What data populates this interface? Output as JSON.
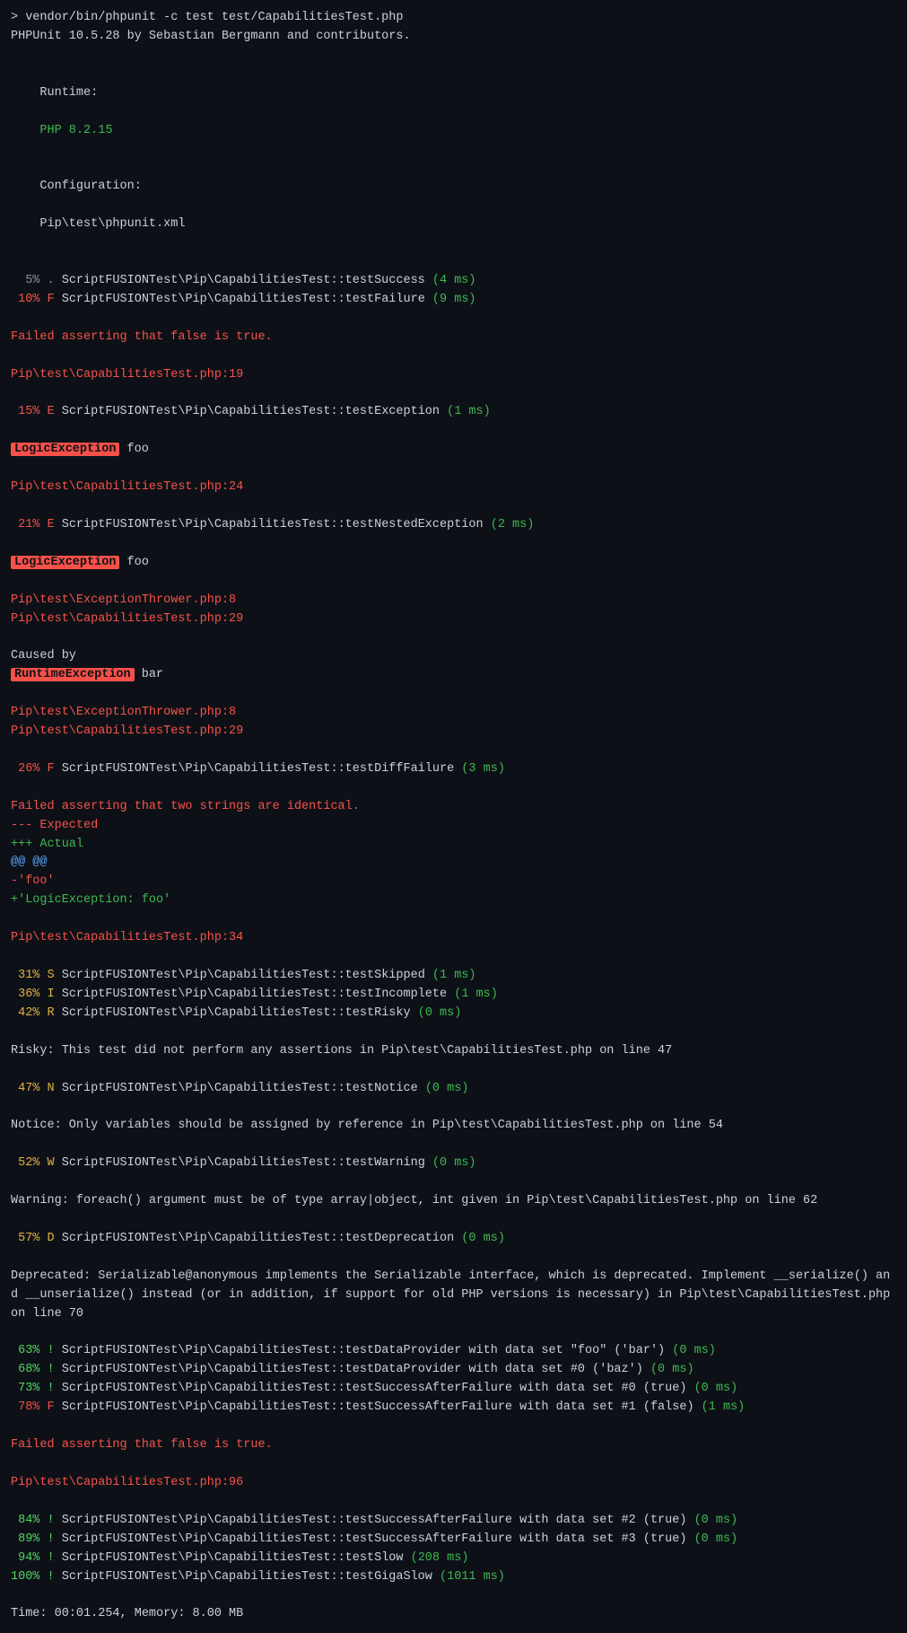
{
  "terminal": {
    "command": "> vendor/bin/phpunit -c test test/CapabilitiesTest.php",
    "phpunit_version": "PHPUnit 10.5.28 by Sebastian Bergmann and contributors.",
    "runtime_label": "Runtime:",
    "runtime_value": "PHP 8.2.15",
    "config_label": "Configuration:",
    "config_value": "Pip\\test\\phpunit.xml",
    "lines": [
      {
        "type": "blank"
      },
      {
        "type": "test_line",
        "percent": "5%",
        "status": ".",
        "status_color": "green",
        "test": "ScriptFUSIONTest\\Pip\\CapabilitiesTest::testSuccess",
        "time": "(4 ms)"
      },
      {
        "type": "test_line",
        "percent": "10%",
        "status": "F",
        "status_color": "red",
        "test": "ScriptFUSIONTest\\Pip\\CapabilitiesTest::testFailure",
        "time": "(9 ms)"
      },
      {
        "type": "blank"
      },
      {
        "type": "error_msg",
        "text": "Failed asserting that false is true."
      },
      {
        "type": "blank"
      },
      {
        "type": "file_ref",
        "text": "Pip\\test\\CapabilitiesTest.php:19"
      },
      {
        "type": "blank"
      },
      {
        "type": "test_line",
        "percent": "15%",
        "status": "E",
        "status_color": "red",
        "test": "ScriptFUSIONTest\\Pip\\CapabilitiesTest::testException",
        "time": "(1 ms)"
      },
      {
        "type": "blank"
      },
      {
        "type": "exception_line",
        "badge": "LogicException",
        "message": " foo"
      },
      {
        "type": "blank"
      },
      {
        "type": "file_ref",
        "text": "Pip\\test\\CapabilitiesTest.php:24"
      },
      {
        "type": "blank"
      },
      {
        "type": "test_line",
        "percent": "21%",
        "status": "E",
        "status_color": "red",
        "test": "ScriptFUSIONTest\\Pip\\CapabilitiesTest::testNestedException",
        "time": "(2 ms)"
      },
      {
        "type": "blank"
      },
      {
        "type": "exception_line",
        "badge": "LogicException",
        "message": " foo"
      },
      {
        "type": "blank"
      },
      {
        "type": "file_ref",
        "text": "Pip\\test\\ExceptionThrower.php:8"
      },
      {
        "type": "file_ref",
        "text": "Pip\\test\\CapabilitiesTest.php:29"
      },
      {
        "type": "blank"
      },
      {
        "type": "caused_by"
      },
      {
        "type": "exception_line",
        "badge": "RuntimeException",
        "badge_type": "runtime",
        "message": " bar"
      },
      {
        "type": "blank"
      },
      {
        "type": "file_ref",
        "text": "Pip\\test\\ExceptionThrower.php:8"
      },
      {
        "type": "file_ref",
        "text": "Pip\\test\\CapabilitiesTest.php:29"
      },
      {
        "type": "blank"
      },
      {
        "type": "test_line",
        "percent": "26%",
        "status": "F",
        "status_color": "red",
        "test": "ScriptFUSIONTest\\Pip\\CapabilitiesTest::testDiffFailure",
        "time": "(3 ms)"
      },
      {
        "type": "blank"
      },
      {
        "type": "error_msg",
        "text": "Failed asserting that two strings are identical."
      },
      {
        "type": "diff_minus",
        "text": "--- Expected"
      },
      {
        "type": "diff_plus",
        "text": "+++ Actual"
      },
      {
        "type": "diff_at",
        "text": "@@ @@"
      },
      {
        "type": "diff_minus",
        "text": "-'foo'"
      },
      {
        "type": "diff_plus",
        "text": "+'LogicException: foo'"
      },
      {
        "type": "blank"
      },
      {
        "type": "file_ref",
        "text": "Pip\\test\\CapabilitiesTest.php:34"
      },
      {
        "type": "blank"
      },
      {
        "type": "test_line",
        "percent": "31%",
        "status": "S",
        "status_color": "yellow",
        "test": "ScriptFUSIONTest\\Pip\\CapabilitiesTest::testSkipped",
        "time": "(1 ms)"
      },
      {
        "type": "test_line",
        "percent": "36%",
        "status": "I",
        "status_color": "yellow",
        "test": "ScriptFUSIONTest\\Pip\\CapabilitiesTest::testIncomplete",
        "time": "(1 ms)"
      },
      {
        "type": "test_line",
        "percent": "42%",
        "status": "R",
        "status_color": "yellow",
        "test": "ScriptFUSIONTest\\Pip\\CapabilitiesTest::testRisky",
        "time": "(0 ms)"
      },
      {
        "type": "blank"
      },
      {
        "type": "warning_msg",
        "text": "Risky: This test did not perform any assertions in Pip\\test\\CapabilitiesTest.php on line 47"
      },
      {
        "type": "blank"
      },
      {
        "type": "test_line",
        "percent": "47%",
        "status": "N",
        "status_color": "yellow",
        "test": "ScriptFUSIONTest\\Pip\\CapabilitiesTest::testNotice",
        "time": "(0 ms)"
      },
      {
        "type": "blank"
      },
      {
        "type": "warning_msg",
        "text": "Notice: Only variables should be assigned by reference in Pip\\test\\CapabilitiesTest.php on line 54"
      },
      {
        "type": "blank"
      },
      {
        "type": "test_line",
        "percent": "52%",
        "status": "W",
        "status_color": "yellow",
        "test": "ScriptFUSIONTest\\Pip\\CapabilitiesTest::testWarning",
        "time": "(0 ms)"
      },
      {
        "type": "blank"
      },
      {
        "type": "warning_msg",
        "text": "Warning: foreach() argument must be of type array|object, int given in Pip\\test\\CapabilitiesTest.php on line 62"
      },
      {
        "type": "blank"
      },
      {
        "type": "test_line",
        "percent": "57%",
        "status": "D",
        "status_color": "yellow",
        "test": "ScriptFUSIONTest\\Pip\\CapabilitiesTest::testDeprecation",
        "time": "(0 ms)"
      },
      {
        "type": "blank"
      },
      {
        "type": "warning_msg",
        "text": "Deprecated: Serializable@anonymous implements the Serializable interface, which is deprecated. Implement __serialize() and __unserialize() instead (or in addition, if support for old PHP versions is necessary) in Pip\\test\\CapabilitiesTest.php on line 70"
      },
      {
        "type": "blank"
      },
      {
        "type": "test_line",
        "percent": "63%",
        "status": "!",
        "status_color": "cyan",
        "test": "ScriptFUSIONTest\\Pip\\CapabilitiesTest::testDataProvider with data set \"foo\" ('bar')",
        "time": "(0 ms)"
      },
      {
        "type": "test_line",
        "percent": "68%",
        "status": "!",
        "status_color": "cyan",
        "test": "ScriptFUSIONTest\\Pip\\CapabilitiesTest::testDataProvider with data set #0 ('baz')",
        "time": "(0 ms)"
      },
      {
        "type": "test_line",
        "percent": "73%",
        "status": "!",
        "status_color": "cyan",
        "test": "ScriptFUSIONTest\\Pip\\CapabilitiesTest::testSuccessAfterFailure with data set #0 (true)",
        "time": "(0 ms)"
      },
      {
        "type": "test_line",
        "percent": "78%",
        "status": "F",
        "status_color": "red",
        "test": "ScriptFUSIONTest\\Pip\\CapabilitiesTest::testSuccessAfterFailure with data set #1 (false)",
        "time": "(1 ms)"
      },
      {
        "type": "blank"
      },
      {
        "type": "error_msg",
        "text": "Failed asserting that false is true."
      },
      {
        "type": "blank"
      },
      {
        "type": "file_ref",
        "text": "Pip\\test\\CapabilitiesTest.php:96"
      },
      {
        "type": "blank"
      },
      {
        "type": "test_line",
        "percent": "84%",
        "status": "!",
        "status_color": "cyan",
        "test": "ScriptFUSIONTest\\Pip\\CapabilitiesTest::testSuccessAfterFailure with data set #2 (true)",
        "time": "(0 ms)"
      },
      {
        "type": "test_line",
        "percent": "89%",
        "status": "!",
        "status_color": "cyan",
        "test": "ScriptFUSIONTest\\Pip\\CapabilitiesTest::testSuccessAfterFailure with data set #3 (true)",
        "time": "(0 ms)"
      },
      {
        "type": "test_line",
        "percent": "94%",
        "status": "!",
        "status_color": "cyan",
        "test": "ScriptFUSIONTest\\Pip\\CapabilitiesTest::testSlow",
        "time": "(208 ms)"
      },
      {
        "type": "test_line",
        "percent": "100%",
        "status": "!",
        "status_color": "cyan",
        "test": "ScriptFUSIONTest\\Pip\\CapabilitiesTest::testGigaSlow",
        "time": "(1011 ms)"
      },
      {
        "type": "blank"
      },
      {
        "type": "summary",
        "text": "Time: 00:01.254, Memory: 8.00 MB"
      }
    ]
  }
}
